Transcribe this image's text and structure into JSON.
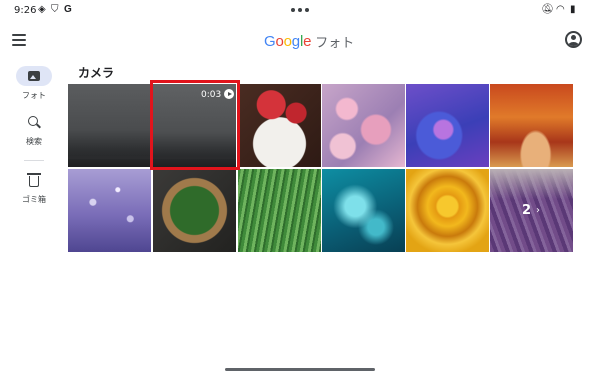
{
  "status_bar": {
    "time": "9:26",
    "left_icons": [
      "location-icon",
      "shield-icon",
      "google-g-icon"
    ],
    "right_icons": [
      "notifications-off-icon",
      "wifi-icon",
      "battery-icon"
    ]
  },
  "app_bar": {
    "logo_text": "Google",
    "app_name": "フォト",
    "logo_colors": [
      "#4285f4",
      "#ea4335",
      "#fbbc05",
      "#4285f4",
      "#34a853",
      "#ea4335"
    ]
  },
  "nav": {
    "items": [
      {
        "label": "フォト",
        "icon": "photo-icon",
        "active": true
      },
      {
        "label": "検索",
        "icon": "search-icon",
        "active": false
      },
      {
        "label": "ゴミ箱",
        "icon": "trash-icon",
        "active": false
      }
    ]
  },
  "main": {
    "section_title": "カメラ",
    "video_duration": "0:03",
    "more_count": "2",
    "more_chevron": "›"
  },
  "colors": {
    "highlight": "#e1141c",
    "active_nav_bg": "#dfe5f6"
  }
}
